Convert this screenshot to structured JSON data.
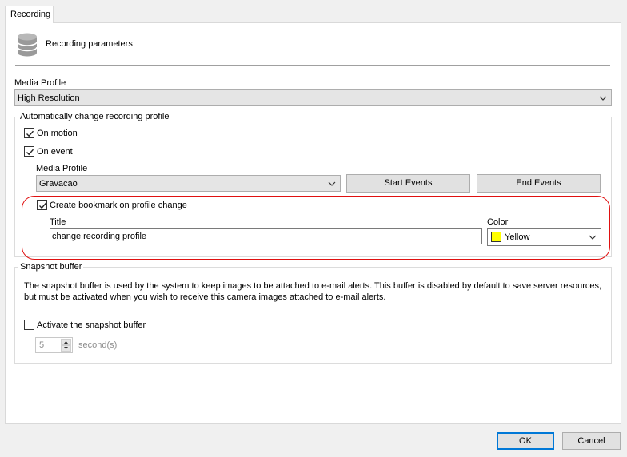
{
  "tab": {
    "label": "Recording"
  },
  "header": {
    "title": "Recording parameters",
    "icon": "database-icon"
  },
  "media_profile": {
    "label": "Media Profile",
    "value": "High Resolution"
  },
  "auto_change": {
    "group_label": "Automatically change recording profile",
    "on_motion": {
      "label": "On motion",
      "checked": true
    },
    "on_event": {
      "label": "On event",
      "checked": true
    },
    "event_profile": {
      "label": "Media Profile",
      "value": "Gravacao"
    },
    "start_events_label": "Start Events",
    "end_events_label": "End Events",
    "bookmark": {
      "label": "Create bookmark on profile change",
      "checked": true,
      "title_label": "Title",
      "title_value": "change recording profile",
      "color_label": "Color",
      "color_value": "Yellow",
      "color_hex": "#ffff00"
    }
  },
  "snapshot": {
    "group_label": "Snapshot buffer",
    "description": "The snapshot buffer is used by the system to keep images to be attached to e-mail alerts. This buffer is disabled by default to save server resources, but must be activated when you wish to receive this camera images attached to e-mail alerts.",
    "activate_label": "Activate the snapshot buffer",
    "activate_checked": false,
    "seconds_value": "5",
    "seconds_unit": "second(s)"
  },
  "footer": {
    "ok_label": "OK",
    "cancel_label": "Cancel"
  },
  "colors": {
    "accent_border": "#0078d7",
    "highlight": "#e01010"
  }
}
